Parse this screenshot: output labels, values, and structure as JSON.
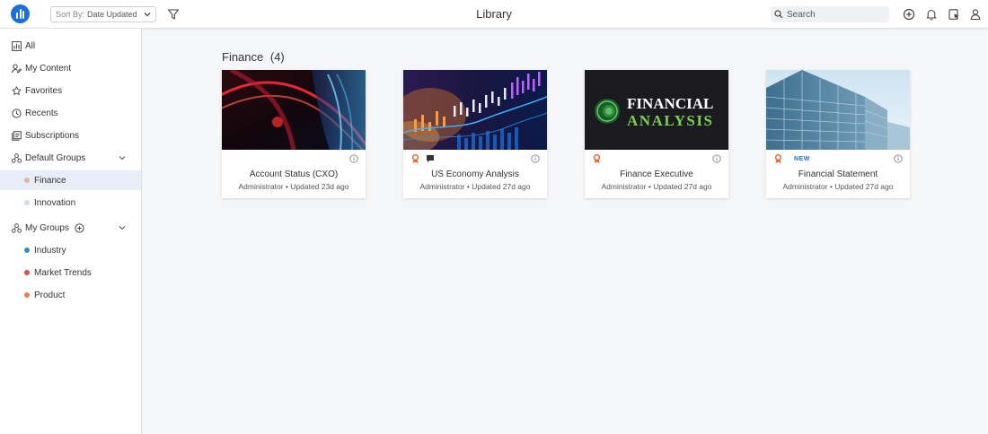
{
  "header": {
    "sort_prefix": "Sort By:",
    "sort_value": "Date Updated",
    "title": "Library",
    "search_placeholder": "Search"
  },
  "sidebar": {
    "items": [
      {
        "label": "All",
        "icon": "bar-chart-icon"
      },
      {
        "label": "My Content",
        "icon": "user-edit-icon"
      },
      {
        "label": "Favorites",
        "icon": "star-icon"
      },
      {
        "label": "Recents",
        "icon": "clock-icon"
      },
      {
        "label": "Subscriptions",
        "icon": "subscription-icon"
      },
      {
        "label": "Default Groups",
        "icon": "groups-icon"
      },
      {
        "label": "Finance",
        "color": "#e8b0a0"
      },
      {
        "label": "Innovation",
        "color": "#cce3ec"
      },
      {
        "label": "My Groups",
        "icon": "groups-icon"
      },
      {
        "label": "Industry",
        "color": "#2f8bd6"
      },
      {
        "label": "Market Trends",
        "color": "#e0503f"
      },
      {
        "label": "Product",
        "color": "#ef7a4a"
      }
    ]
  },
  "main": {
    "section_title": "Finance",
    "section_count": "(4)",
    "cards": [
      {
        "title": "Account Status (CXO)",
        "meta": "Administrator • Updated 23d ago"
      },
      {
        "title": "US Economy Analysis",
        "meta": "Administrator • Updated 27d ago"
      },
      {
        "title": "Finance Executive",
        "meta": "Administrator • Updated 27d ago"
      },
      {
        "title": "Financial Statement",
        "meta": "Administrator • Updated 27d ago",
        "badge": "NEW"
      }
    ],
    "thumb3_line1": "FINANCIAL",
    "thumb3_line2": "ANALYSIS"
  },
  "colors": {
    "accent": "#1d6fd8",
    "certified": "#f0602a"
  }
}
